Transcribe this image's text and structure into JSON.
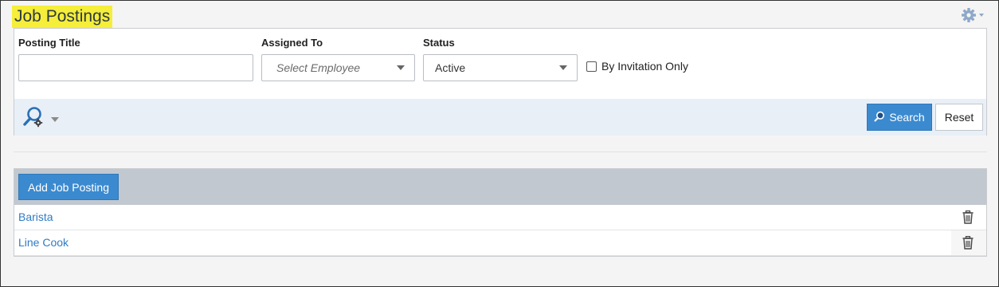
{
  "header": {
    "title": "Job Postings",
    "settings_icon": "gear-icon"
  },
  "filters": {
    "posting_title": {
      "label": "Posting Title",
      "value": "",
      "placeholder": ""
    },
    "assigned_to": {
      "label": "Assigned To",
      "value": "Select Employee"
    },
    "status": {
      "label": "Status",
      "value": "Active"
    },
    "invitation_only": {
      "label": "By Invitation Only",
      "checked": false
    }
  },
  "actions": {
    "advanced_search_icon": "advanced-search-icon",
    "search_label": "Search",
    "reset_label": "Reset"
  },
  "list": {
    "add_label": "Add Job Posting",
    "rows": [
      {
        "name": "Barista"
      },
      {
        "name": "Line Cook"
      }
    ]
  },
  "colors": {
    "accent": "#3b8ad0",
    "highlight": "#f5ee3a",
    "link": "#2f7bc4",
    "list_header": "#c1c8cf",
    "action_bar": "#e8eff7"
  }
}
